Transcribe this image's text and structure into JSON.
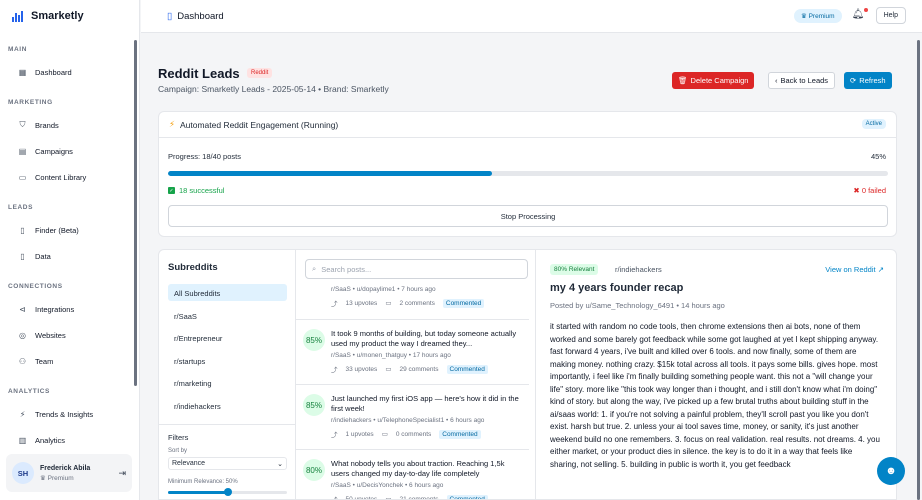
{
  "app": {
    "name": "Smarketly"
  },
  "sidebar": {
    "sections": [
      {
        "title": "MAIN",
        "items": [
          {
            "label": "Dashboard",
            "icon": "grid-icon"
          }
        ]
      },
      {
        "title": "MARKETING",
        "items": [
          {
            "label": "Brands",
            "icon": "shield-icon"
          },
          {
            "label": "Campaigns",
            "icon": "calendar-icon"
          },
          {
            "label": "Content Library",
            "icon": "message-icon"
          }
        ]
      },
      {
        "title": "LEADS",
        "items": [
          {
            "label": "Finder (Beta)",
            "icon": "finder-icon"
          },
          {
            "label": "Data",
            "icon": "document-icon"
          }
        ]
      },
      {
        "title": "CONNECTIONS",
        "items": [
          {
            "label": "Integrations",
            "icon": "share-icon"
          },
          {
            "label": "Websites",
            "icon": "globe-icon"
          },
          {
            "label": "Team",
            "icon": "team-icon"
          }
        ]
      },
      {
        "title": "ANALYTICS",
        "items": [
          {
            "label": "Trends & Insights",
            "icon": "trend-icon"
          },
          {
            "label": "Analytics",
            "icon": "chart-icon"
          }
        ]
      }
    ],
    "user": {
      "initials": "SH",
      "name": "Frederick Abila",
      "plan": "Premium"
    }
  },
  "topbar": {
    "title": "Dashboard",
    "premium": "Premium",
    "help": "Help"
  },
  "page": {
    "title": "Reddit Leads",
    "badge": "Reddit",
    "subtitle": "Campaign: Smarketly Leads - 2025-05-14 • Brand: Smarketly",
    "delete_label": "Delete Campaign",
    "back_label": "Back to Leads",
    "refresh_label": "Refresh"
  },
  "engagement": {
    "title": "Automated Reddit Engagement (Running)",
    "status": "Active",
    "progress_label": "Progress: 18/40 posts",
    "progress_pct_label": "45%",
    "progress_fraction": 0.45,
    "success_label": "18 successful",
    "fail_label": "0 failed",
    "stop_label": "Stop Processing"
  },
  "subreddits": {
    "title": "Subreddits",
    "items": [
      "All Subreddits",
      "r/SaaS",
      "r/Entrepreneur",
      "r/startups",
      "r/marketing",
      "r/indiehackers"
    ],
    "filters_title": "Filters",
    "sort_label": "Sort by",
    "sort_value": "Relevance",
    "min_label": "Minimum Relevance: 50%",
    "min_fraction": 0.5
  },
  "posts": {
    "search_placeholder": "Search posts...",
    "items": [
      {
        "score": "",
        "title": "",
        "meta": "r/SaaS • u/dopaylime1 • 7 hours ago",
        "upvotes": "13 upvotes",
        "comments": "2 comments",
        "status": "Commented"
      },
      {
        "score": "85%",
        "title": "It took 9 months of building, but today someone actually used my product the way I dreamed they...",
        "meta": "r/SaaS • u/monen_thatguy • 17 hours ago",
        "upvotes": "33 upvotes",
        "comments": "29 comments",
        "status": "Commented"
      },
      {
        "score": "85%",
        "title": "Just launched my first iOS app — here's how it did in the first week!",
        "meta": "r/indiehackers • u/TelephoneSpecialist1 • 6 hours ago",
        "upvotes": "1 upvotes",
        "comments": "0 comments",
        "status": "Commented"
      },
      {
        "score": "80%",
        "title": "What nobody tells you about traction. Reaching 1,5k users changed my day-to-day life completely",
        "meta": "r/SaaS • u/DecisYonchek • 6 hours ago",
        "upvotes": "50 upvotes",
        "comments": "21 comments",
        "status": "Commented"
      }
    ]
  },
  "detail": {
    "relevance": "80% Relevant",
    "subreddit": "r/indiehackers",
    "view_label": "View on Reddit",
    "title": "my 4 years founder recap",
    "meta": "Posted by u/Same_Technology_6491 • 14 hours ago",
    "body": "it started with random no code tools, then chrome extensions then ai bots, none of them worked and some barely got feedback while some got laughed at yet I kept shipping anyway. fast forward 4 years, i've built and killed over 6 tools. and now finally, some of them are making money. nothing crazy. $15k total across all tools. it pays some bills. gives hope. most importantly, i feel like i'm finally building something people want. this not a \"will change your life\" story. more like \"this took way longer than i thought, and i still don't know what i'm doing\" kind of story. but along the way, i've picked up a few brutal truths about building stuff in the ai/saas world: 1. if you're not solving a painful problem, they'll scroll past you like you don't exist. harsh but true. 2. unless your ai tool saves time, money, or sanity, it's just another weekend build no one remembers. 3. focus on real validation. real results. not dreams. 4. you either market, or your product dies in silence. the key is to do it in a way that feels like sharing, not selling. 5. building in public is worth it, you get feedback"
  },
  "colors": {
    "accent": "#0284c7",
    "danger": "#dc2626",
    "success": "#16a34a"
  }
}
